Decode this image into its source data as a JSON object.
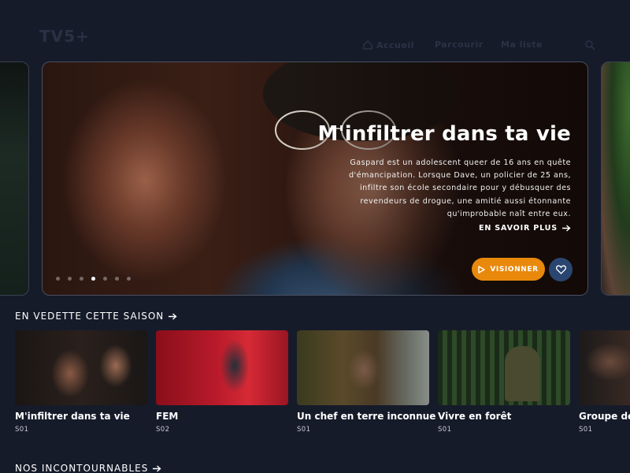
{
  "header": {
    "logo": "TV5+",
    "nav": [
      "Accueil",
      "Parcourir",
      "Ma liste"
    ]
  },
  "hero": {
    "title": "M'infiltrer dans ta vie",
    "description": "Gaspard est un adolescent queer de 16 ans en quête d'émancipation. Lorsque Dave, un policier de 25 ans, infiltre son école secondaire pour y débusquer des revendeurs de drogue, une amitié aussi étonnante qu'improbable naît entre eux.",
    "learn_more": "EN SAVOIR PLUS",
    "watch": "VISIONNER",
    "slide_count": 7,
    "active_slide": 4
  },
  "featured": {
    "title": "EN VEDETTE CETTE SAISON",
    "items": [
      {
        "title": "M'infiltrer dans ta vie",
        "season": "S01"
      },
      {
        "title": "FEM",
        "season": "S02"
      },
      {
        "title": "Un chef en terre inconnue",
        "season": "S01"
      },
      {
        "title": "Vivre en forêt",
        "season": "S01"
      },
      {
        "title": "Groupe de",
        "season": "S01"
      }
    ]
  },
  "must_watch": {
    "title": "NOS INCONTOURNABLES"
  },
  "colors": {
    "background": "#161b2a",
    "accent": "#e8890c",
    "favorite": "#2a4670"
  }
}
